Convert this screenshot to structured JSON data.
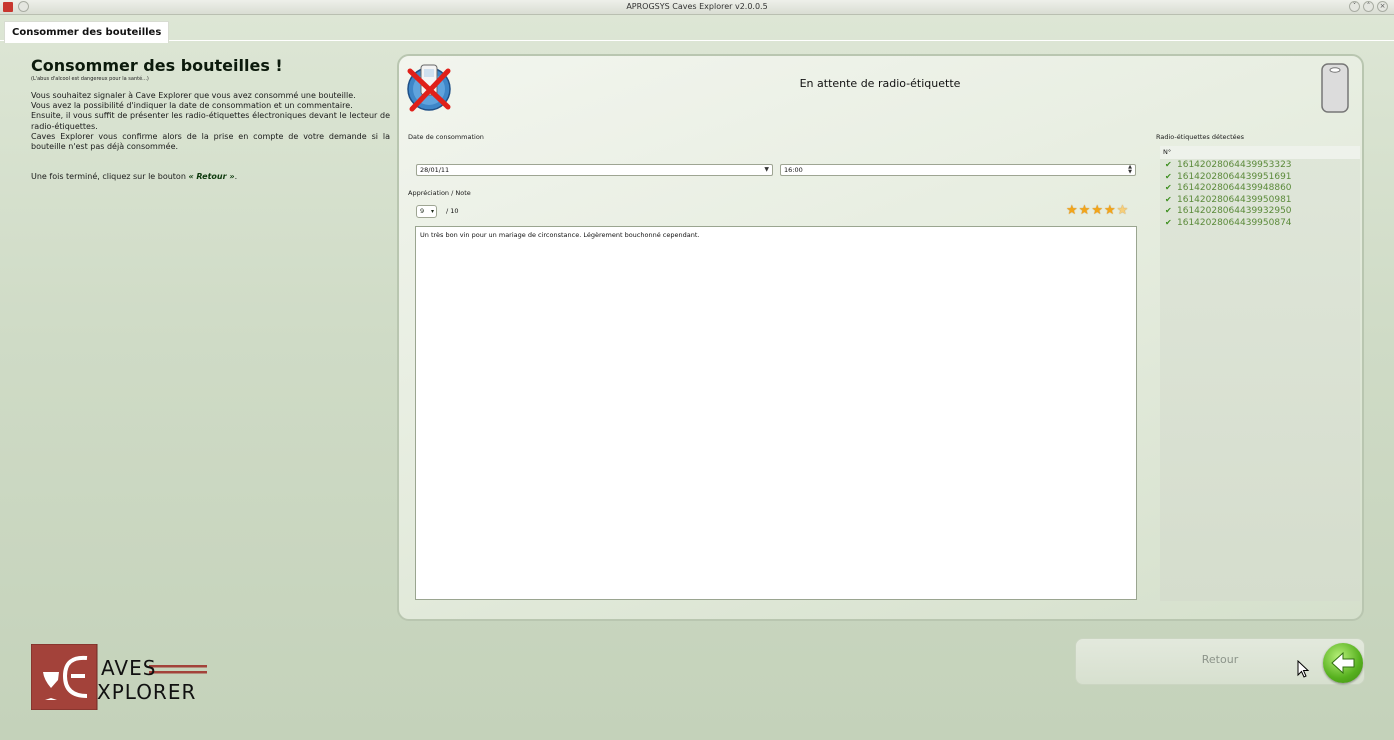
{
  "window": {
    "title": "APROGSYS Caves Explorer v2.0.0.5"
  },
  "tabs": [
    {
      "label": "Consommer des bouteilles",
      "active": true
    }
  ],
  "intro": {
    "title": "Consommer des bouteilles !",
    "subtitle": "(L'abus d'alcool est dangereux pour la santé...)",
    "paragraphs": [
      "Vous souhaitez signaler à Cave Explorer que vous avez consommé une bouteille.",
      "Vous avez la possibilité d'indiquer la date de consommation et un commentaire.",
      "Ensuite, il vous suffit de présenter les radio-étiquettes électroniques devant le lecteur de radio-étiquettes.",
      "Caves Explorer vous confirme alors de la prise en compte de votre demande si la bouteille n'est pas déjà consommée."
    ],
    "finish_prefix": "Une fois terminé, cliquez sur le bouton ",
    "finish_button": "« Retour »",
    "finish_suffix": "."
  },
  "panel": {
    "status": "En attente de radio-étiquette",
    "date_label": "Date de consommation",
    "date_value": "28/01/11",
    "time_value": "16:00",
    "note_label": "Appréciation / Note",
    "note_value": "9",
    "note_max": "/ 10",
    "rating_fraction": 0.9,
    "comment": "Un très bon vin pour un mariage de circonstance. Légèrement bouchonné cependant.",
    "tags_label": "Radio-étiquettes détectées",
    "tags_column": "N°",
    "tags": [
      "16142028064439953323",
      "16142028064439951691",
      "16142028064439948860",
      "16142028064439950981",
      "16142028064439932950",
      "16142028064439950874"
    ]
  },
  "brand": {
    "line1": "AVES",
    "line2": "XPLORER"
  },
  "footer": {
    "back_label": "Retour"
  },
  "colors": {
    "accent_green": "#5b8a3a",
    "brand_red": "#a3423a",
    "star": "#f2a51a"
  }
}
